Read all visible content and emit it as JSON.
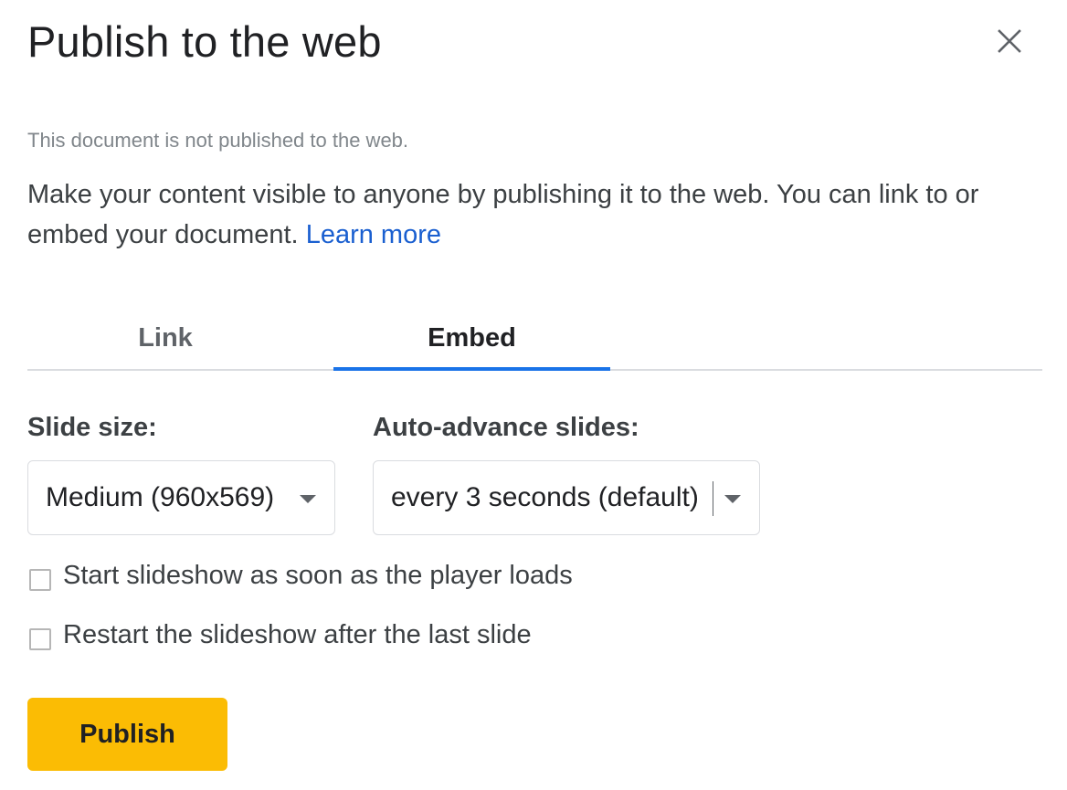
{
  "dialog": {
    "title": "Publish to the web",
    "close_icon": "close-icon"
  },
  "status_text": "This document is not published to the web.",
  "description": {
    "text": "Make your content visible to anyone by publishing it to the web. You can link to or embed your document.",
    "learn_more": "Learn more"
  },
  "tabs": [
    {
      "label": "Link",
      "active": false
    },
    {
      "label": "Embed",
      "active": true
    }
  ],
  "options": {
    "slide_size": {
      "label": "Slide size:",
      "value": "Medium (960x569)"
    },
    "auto_advance": {
      "label": "Auto-advance slides:",
      "value": "every 3 seconds (default)"
    }
  },
  "checkboxes": [
    {
      "label": "Start slideshow as soon as the player loads",
      "checked": false
    },
    {
      "label": "Restart the slideshow after the last slide",
      "checked": false
    }
  ],
  "publish_button": {
    "label": "Publish"
  },
  "colors": {
    "accent": "#1a73e8",
    "link": "#1a5fd0",
    "publish": "#fbbc04"
  }
}
